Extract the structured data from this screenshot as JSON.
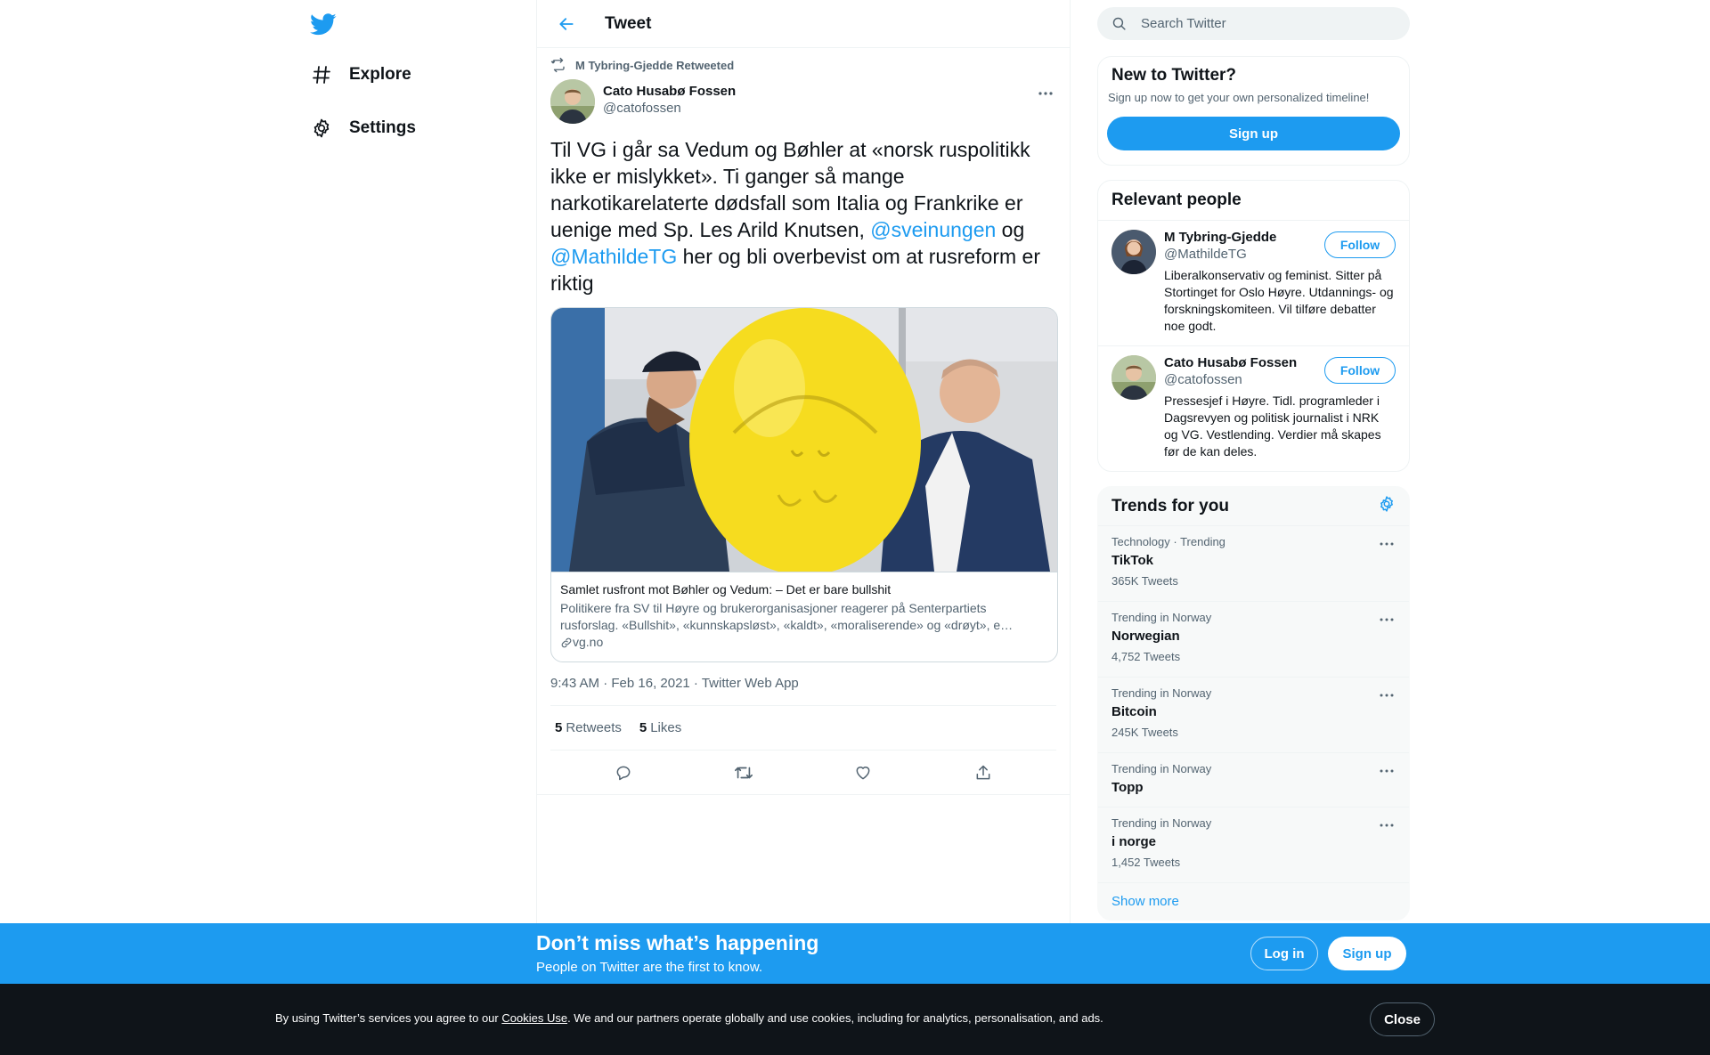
{
  "nav": {
    "items": [
      {
        "label": "Explore",
        "icon": "hashtag-icon"
      },
      {
        "label": "Settings",
        "icon": "gear-icon"
      }
    ]
  },
  "header": {
    "title": "Tweet"
  },
  "tweet": {
    "retweeted_by": "M Tybring-Gjedde Retweeted",
    "author_name": "Cato Husabø Fossen",
    "author_handle": "@catofossen",
    "text_1": "Til VG i går sa Vedum og Bøhler at «norsk ruspolitikk ikke er mislykket». Ti ganger så mange narkotikarelaterte dødsfall som Italia og Frankrike er uenige med Sp. Les Arild Knutsen, ",
    "mention_1": "@sveinungen",
    "text_2": " og ",
    "mention_2": "@MathildeTG",
    "text_3": " her og bli overbevist om at rusreform er riktig",
    "card": {
      "title": "Samlet rusfront mot Bøhler og Vedum: – Det er bare bullshit",
      "description": "Politikere fra SV til Høyre og brukerorganisasjoner reagerer på Senterpartiets rusforslag. «Bullshit», «kunnskapsløst», «kaldt», «moraliserende» og «drøyt», e…",
      "domain": "vg.no"
    },
    "timestamp": "9:43 AM · Feb 16, 2021 · Twitter Web App",
    "retweets": "5",
    "retweets_label": "Retweets",
    "likes": "5",
    "likes_label": "Likes"
  },
  "search": {
    "placeholder": "Search Twitter"
  },
  "new_to_twitter": {
    "title": "New to Twitter?",
    "subtitle": "Sign up now to get your own personalized timeline!",
    "button": "Sign up"
  },
  "relevant_people": {
    "title": "Relevant people",
    "people": [
      {
        "name": "M Tybring-Gjedde",
        "handle": "@MathildeTG",
        "bio": "Liberalkonservativ og feminist. Sitter på Stortinget for Oslo Høyre. Utdannings- og forskningskomiteen. Vil tilføre debatter noe godt.",
        "button": "Follow"
      },
      {
        "name": "Cato Husabø Fossen",
        "handle": "@catofossen",
        "bio": "Pressesjef i Høyre. Tidl. programleder i Dagsrevyen og politisk journalist i NRK og VG. Vestlending. Verdier må skapes før de kan deles.",
        "button": "Follow"
      }
    ]
  },
  "trends": {
    "title": "Trends for you",
    "items": [
      {
        "context": "Technology · Trending",
        "name": "TikTok",
        "count": "365K Tweets"
      },
      {
        "context": "Trending in Norway",
        "name": "Norwegian",
        "count": "4,752 Tweets"
      },
      {
        "context": "Trending in Norway",
        "name": "Bitcoin",
        "count": "245K Tweets"
      },
      {
        "context": "Trending in Norway",
        "name": "Topp",
        "count": ""
      },
      {
        "context": "Trending in Norway",
        "name": "i norge",
        "count": "1,452 Tweets"
      }
    ],
    "show_more": "Show more"
  },
  "banner": {
    "title": "Don’t miss what’s happening",
    "subtitle": "People on Twitter are the first to know.",
    "login": "Log in",
    "signup": "Sign up"
  },
  "cookie": {
    "text_before": "By using Twitter’s services you agree to our ",
    "link": "Cookies Use",
    "text_after": ". We and our partners operate globally and use cookies, including for analytics, personalisation, and ads.",
    "close": "Close"
  },
  "colors": {
    "accent": "#1d9bf0",
    "text": "#0f1419",
    "muted": "#536471",
    "cookie_bg": "#0f1419"
  }
}
